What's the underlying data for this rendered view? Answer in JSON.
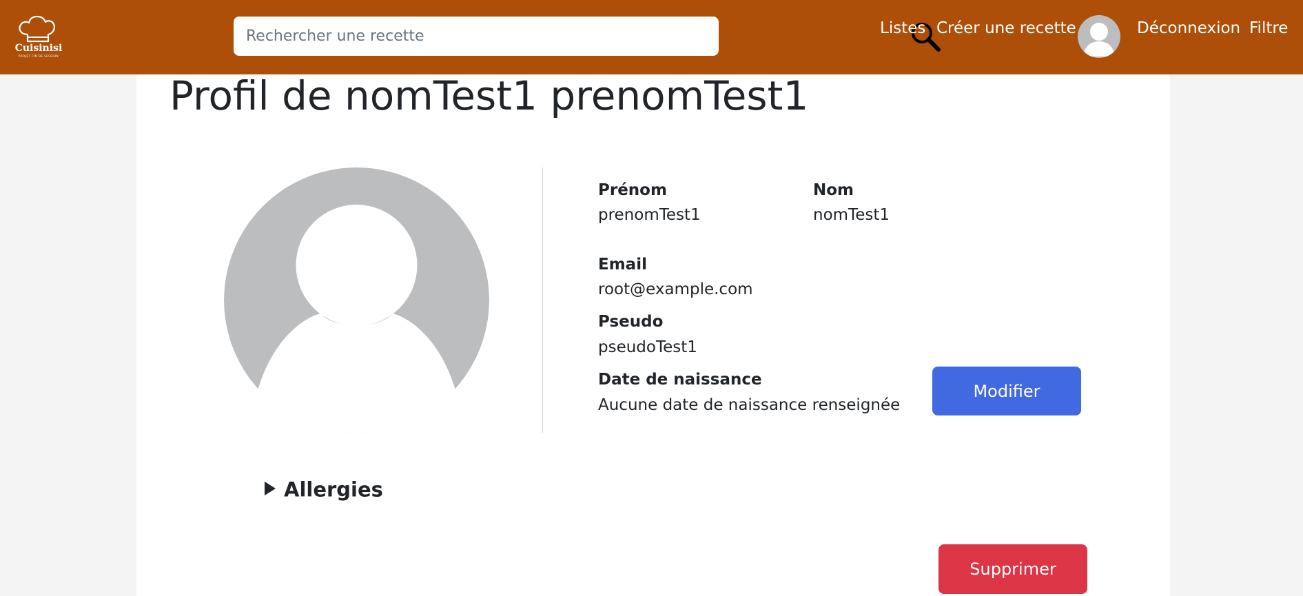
{
  "brand": {
    "name": "Cuisinisi",
    "tagline": "PROJET FIN DE SESSION"
  },
  "search": {
    "placeholder": "Rechercher une recette",
    "value": ""
  },
  "nav": {
    "listes": "Listes",
    "creer_recette": "Créer une recette",
    "deconnexion": "Déconnexion",
    "filtre": "Filtre"
  },
  "profile": {
    "title": "Profil de nomTest1 prenomTest1",
    "prenom_label": "Prénom",
    "prenom_value": "prenomTest1",
    "nom_label": "Nom",
    "nom_value": "nomTest1",
    "email_label": "Email",
    "email_value": "root@example.com",
    "pseudo_label": "Pseudo",
    "pseudo_value": "pseudoTest1",
    "naissance_label": "Date de naissance",
    "naissance_value": "Aucune date de naissance renseignée",
    "modifier_label": "Modifier",
    "allergies_label": "Allergies",
    "supprimer_label": "Supprimer"
  },
  "colors": {
    "header": "#ad4f08",
    "primary": "#4169e1",
    "danger": "#dc3545",
    "avatar_grey": "#bcbdbf"
  },
  "icons": {
    "logo": "chef-hat-icon",
    "search": "search-icon",
    "avatar": "user-avatar-icon",
    "allergies_toggle": "triangle-right-icon"
  }
}
